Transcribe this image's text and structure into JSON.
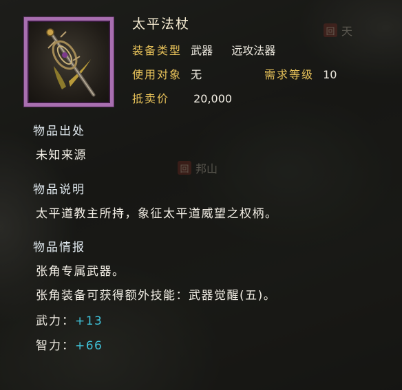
{
  "item": {
    "name": "太平法杖",
    "type_label": "装备类型",
    "type_value_1": "武器",
    "type_value_2": "远攻法器",
    "target_label": "使用对象",
    "target_value": "无",
    "level_label": "需求等级",
    "level_value": "10",
    "price_label": "抵卖价",
    "price_value": "20,000",
    "icon": "staff-icon"
  },
  "sections": {
    "origin": {
      "heading": "物品出处",
      "text": "未知来源"
    },
    "description": {
      "heading": "物品说明",
      "text": "太平道教主所持，象征太平道威望之权柄。"
    },
    "info": {
      "heading": "物品情报",
      "line1": "张角专属武器。",
      "line2": "张角装备可获得额外技能：武器觉醒(五)。",
      "stats": [
        {
          "name": "武力：",
          "value": "+13"
        },
        {
          "name": "智力：",
          "value": "+66"
        }
      ]
    }
  },
  "map_labels": {
    "seal_1": "回",
    "label_1": "天",
    "seal_2": "回",
    "label_2": "邦山"
  },
  "colors": {
    "label_gold": "#e9c35a",
    "stat_cyan": "#3fc2d8",
    "frame_purple": "#a86fb0"
  }
}
